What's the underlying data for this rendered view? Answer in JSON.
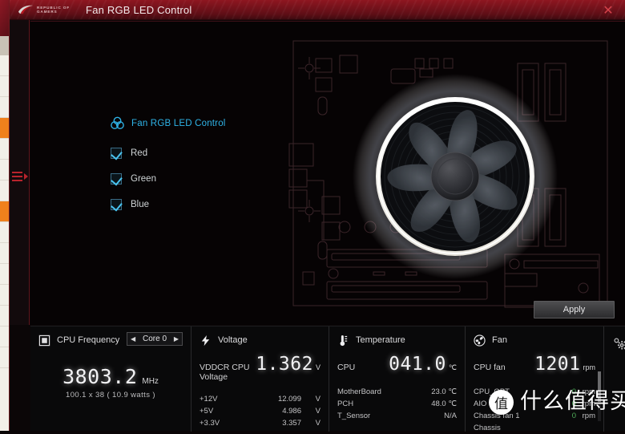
{
  "window": {
    "brand_line1": "REPUBLIC OF",
    "brand_line2": "GAMERS",
    "title": "Fan RGB LED Control",
    "close_label": "✕",
    "logo_name": "rog-logo"
  },
  "left_rail": {
    "menu_icon": "hamburger-menu-icon"
  },
  "controls": {
    "header": {
      "icon": "rgb-color-wheel-icon",
      "label": "Fan RGB LED Control"
    },
    "items": [
      {
        "label": "Red",
        "checked": true
      },
      {
        "label": "Green",
        "checked": true
      },
      {
        "label": "Blue",
        "checked": true
      }
    ]
  },
  "stage": {
    "illustration": "motherboard-rgb-fan-illustration",
    "apply_label": "Apply"
  },
  "monitor": {
    "cpu_frequency": {
      "icon": "cpu-chip-icon",
      "title": "CPU Frequency",
      "core_selector": {
        "value": "Core 0",
        "prev": "◀",
        "next": "▶"
      },
      "value": "3803.2",
      "unit": "MHz",
      "detail": "100.1  x  38    ( 10.9 watts )"
    },
    "voltage": {
      "icon": "lightning-bolt-icon",
      "title": "Voltage",
      "primary": {
        "label": "VDDCR CPU Voltage",
        "value": "1.362",
        "unit": "V"
      },
      "rows": [
        {
          "label": "+12V",
          "value": "12.099",
          "unit": "V"
        },
        {
          "label": "+5V",
          "value": "4.986",
          "unit": "V"
        },
        {
          "label": "+3.3V",
          "value": "3.357",
          "unit": "V"
        }
      ]
    },
    "temperature": {
      "icon": "thermometer-icon",
      "title": "Temperature",
      "primary": {
        "label": "CPU",
        "value": "041.0",
        "unit": "℃"
      },
      "rows": [
        {
          "label": "MotherBoard",
          "value": "23.0 ℃"
        },
        {
          "label": "PCH",
          "value": "48.0 ℃"
        },
        {
          "label": "T_Sensor",
          "value": "N/A"
        }
      ]
    },
    "fan": {
      "icon": "fan-icon",
      "title": "Fan",
      "primary": {
        "label": "CPU fan",
        "value": "1201",
        "unit": "rpm"
      },
      "rows": [
        {
          "label": "CPU_OPT",
          "value": "0",
          "unit": "rpm"
        },
        {
          "label": "AIO Pump",
          "value": "0",
          "unit": "rpm"
        },
        {
          "label": "Chassis fan 1",
          "value": "0",
          "unit": "rpm"
        },
        {
          "label": "Chassis",
          "value": "",
          "unit": ""
        }
      ]
    },
    "settings": {
      "icon": "gear-settings-icon"
    }
  },
  "watermark": {
    "badge": "值",
    "text": "什么值得买"
  },
  "colors": {
    "accent_red": "#8e1620",
    "accent_cyan": "#2fb4e8",
    "green_value": "#4fae5a"
  }
}
